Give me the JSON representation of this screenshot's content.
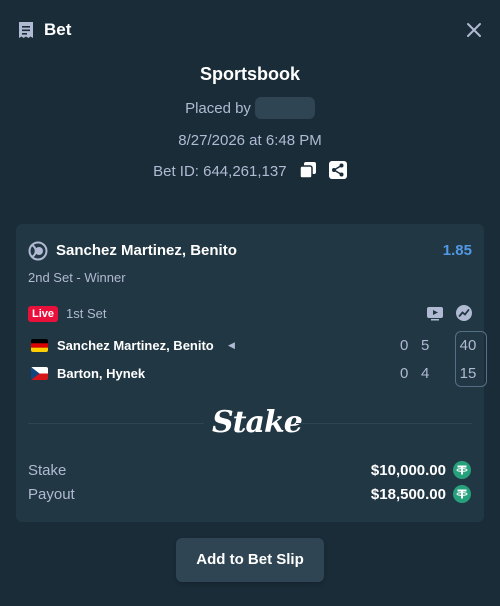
{
  "header": {
    "title": "Bet",
    "icon": "receipt-icon",
    "close_icon": "close-icon"
  },
  "summary": {
    "title": "Sportsbook",
    "placed_by_label": "Placed by",
    "date_time": "8/27/2026 at 6:48 PM",
    "bet_id_label": "Bet ID: 644,261,137",
    "copy_icon": "copy-icon",
    "share_icon": "share-icon"
  },
  "selection": {
    "sport_icon": "tennis-ball-icon",
    "name": "Sanchez Martinez, Benito",
    "odds": "1.85",
    "market": "2nd Set - Winner"
  },
  "match": {
    "live_badge": "Live",
    "period": "1st Set",
    "stream_icon": "stream-icon",
    "stats_icon": "stats-icon",
    "teams": [
      {
        "flag": "germany-flag-icon",
        "name": "Sanchez Martinez, Benito",
        "serving_icon": "serve-indicator-icon",
        "serve_glyph": "◀",
        "sets": "0",
        "games": "5",
        "points": "40"
      },
      {
        "flag": "czech-flag-icon",
        "name": "Barton, Hynek",
        "sets": "0",
        "games": "4",
        "points": "15"
      }
    ]
  },
  "brand": {
    "name": "Stake"
  },
  "payout": {
    "stake_label": "Stake",
    "stake_value": "$10,000.00",
    "payout_label": "Payout",
    "payout_value": "$18,500.00",
    "currency_icon": "tether-icon"
  },
  "actions": {
    "add_to_slip": "Add to Bet Slip"
  },
  "colors": {
    "background": "#1a2c38",
    "card": "#213743",
    "odds": "#5199e4",
    "live": "#e9113c",
    "tether": "#26a17b",
    "button": "#2f4553"
  }
}
